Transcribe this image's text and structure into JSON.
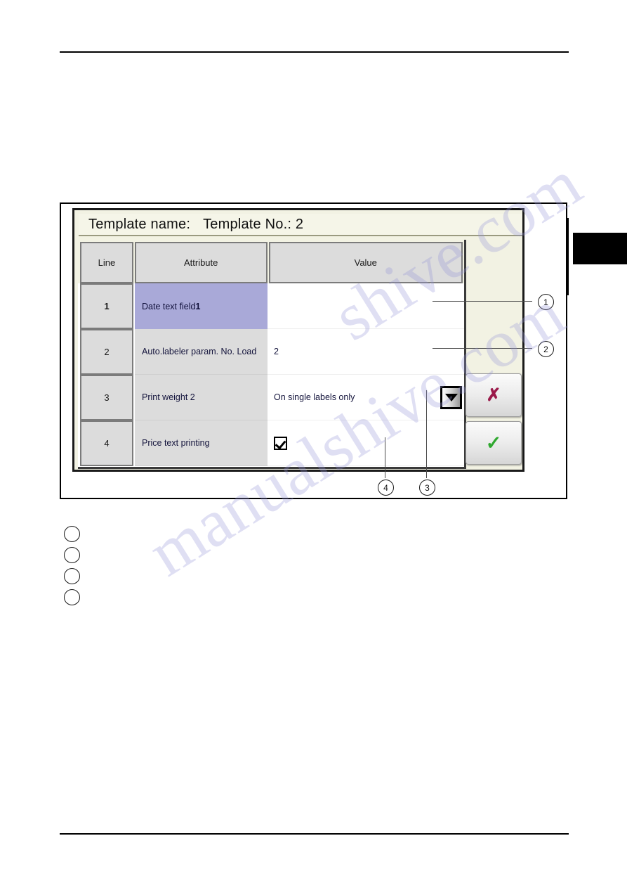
{
  "figure": {
    "panel": {
      "title_label": "Template name:",
      "title_value": "Template No.: 2",
      "table": {
        "headers": [
          "Line",
          "Attribute",
          "Value"
        ],
        "rows": [
          {
            "line": "1",
            "attribute_prefix": "Date text field ",
            "attribute_bold": "1",
            "value": "",
            "selected": true,
            "value_type": "text"
          },
          {
            "line": "2",
            "attribute_prefix": "Auto.labeler param. No. Load",
            "attribute_bold": "",
            "value": "2",
            "selected": false,
            "value_type": "text"
          },
          {
            "line": "3",
            "attribute_prefix": "Print weight 2",
            "attribute_bold": "",
            "value": "On single labels only",
            "selected": false,
            "value_type": "text"
          },
          {
            "line": "4",
            "attribute_prefix": "Price text printing",
            "attribute_bold": "",
            "value": "",
            "selected": false,
            "value_type": "checkbox",
            "checked": true
          }
        ]
      },
      "dropdown": {
        "icon": "chevron-down-icon"
      },
      "buttons": {
        "cancel": {
          "icon": "x-icon",
          "glyph": "✗",
          "color": "#9b1a4a"
        },
        "confirm": {
          "icon": "check-icon",
          "glyph": "✓",
          "color": "#2fa82f"
        }
      }
    },
    "callouts": [
      {
        "number": "1"
      },
      {
        "number": "2"
      },
      {
        "number": "3"
      },
      {
        "number": "4"
      }
    ]
  },
  "legend": {
    "items": [
      {
        "marker": "",
        "text": ""
      },
      {
        "marker": "",
        "text": ""
      },
      {
        "marker": "",
        "text": ""
      },
      {
        "marker": "",
        "text": ""
      }
    ]
  },
  "watermark": {
    "line_a": "manualshive.com",
    "line_b": "shive.com"
  }
}
